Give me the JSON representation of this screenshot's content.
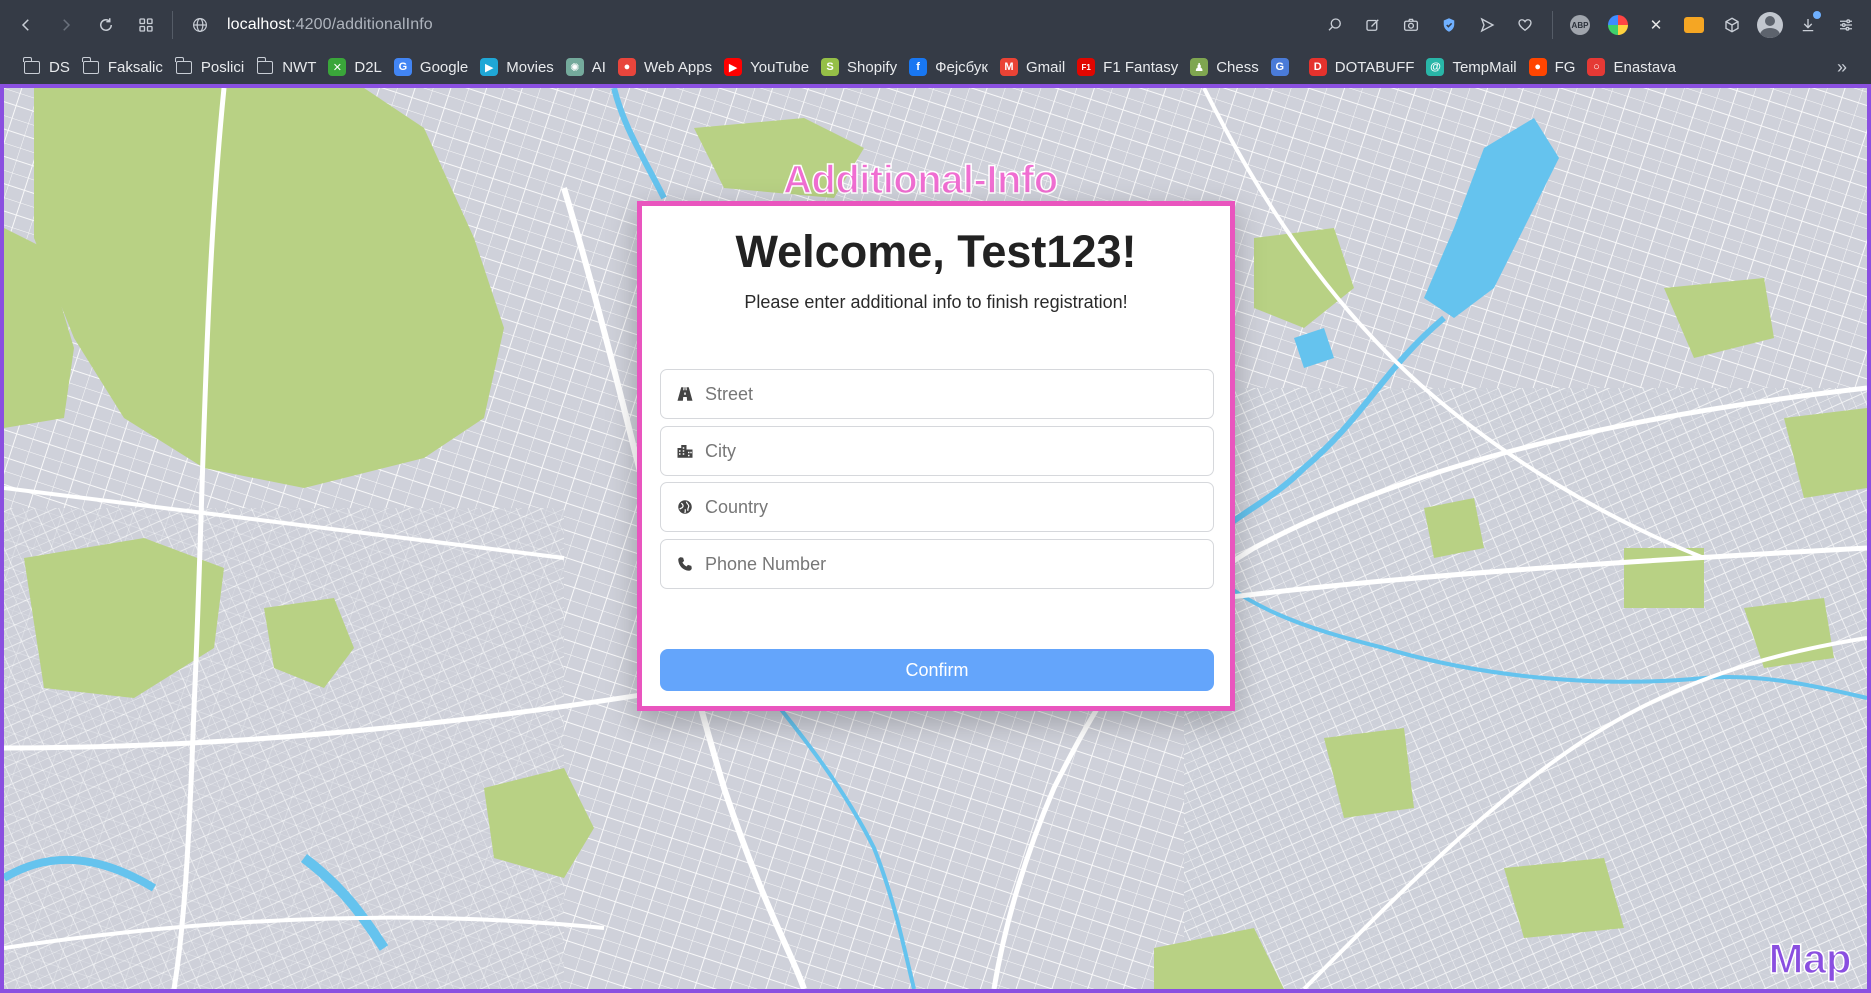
{
  "browser": {
    "url_host": "localhost",
    "url_path": ":4200/additionalInfo"
  },
  "bookmarks": [
    {
      "label": "DS",
      "icon": "folder-icon"
    },
    {
      "label": "Faksalic",
      "icon": "folder-icon"
    },
    {
      "label": "Poslici",
      "icon": "folder-icon"
    },
    {
      "label": "NWT",
      "icon": "folder-icon"
    },
    {
      "label": "D2L",
      "icon": "d2l-icon",
      "color": "#3aa63a"
    },
    {
      "label": "Google",
      "icon": "google-icon",
      "color": "#4285f4"
    },
    {
      "label": "Movies",
      "icon": "movies-icon",
      "color": "#1fa7d6"
    },
    {
      "label": "AI",
      "icon": "openai-icon",
      "color": "#74aa9c"
    },
    {
      "label": "Web Apps",
      "icon": "webapps-icon",
      "color": "#e8453c"
    },
    {
      "label": "YouTube",
      "icon": "youtube-icon",
      "color": "#ff0000"
    },
    {
      "label": "Shopify",
      "icon": "shopify-icon",
      "color": "#95bf47"
    },
    {
      "label": "Фејсбук",
      "icon": "facebook-icon",
      "color": "#1877f2"
    },
    {
      "label": "Gmail",
      "icon": "gmail-icon",
      "color": "#ea4335"
    },
    {
      "label": "F1 Fantasy",
      "icon": "f1-icon",
      "color": "#e10600"
    },
    {
      "label": "Chess",
      "icon": "chess-icon",
      "color": "#7fa650"
    },
    {
      "label": "",
      "icon": "translate-icon",
      "color": "#4a7bd8"
    },
    {
      "label": "DOTABUFF",
      "icon": "dotabuff-icon",
      "color": "#e5322d"
    },
    {
      "label": "TempMail",
      "icon": "tempmail-icon",
      "color": "#29b6a8"
    },
    {
      "label": "FG",
      "icon": "reddit-icon",
      "color": "#ff4500"
    },
    {
      "label": "Enastava",
      "icon": "enastava-icon",
      "color": "#e53935"
    }
  ],
  "card": {
    "label": "Additional-Info",
    "title": "Welcome, Test123!",
    "subtitle": "Please enter additional info to finish registration!",
    "fields": [
      {
        "placeholder": "Street",
        "icon": "road-icon",
        "value": ""
      },
      {
        "placeholder": "City",
        "icon": "city-icon",
        "value": ""
      },
      {
        "placeholder": "Country",
        "icon": "globe-icon",
        "value": ""
      },
      {
        "placeholder": "Phone Number",
        "icon": "phone-icon",
        "value": ""
      }
    ],
    "confirm_label": "Confirm"
  },
  "map": {
    "label": "Map"
  },
  "colors": {
    "accent_pink": "#e955be",
    "accent_purple": "#8a4fe0",
    "button_blue": "#64a5fb"
  }
}
